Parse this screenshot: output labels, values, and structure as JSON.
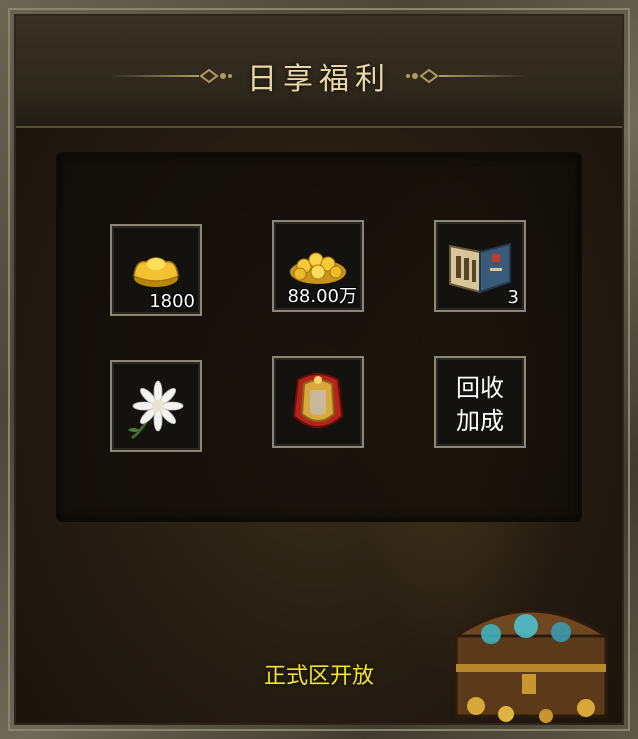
{
  "header": {
    "title": "日享福利"
  },
  "rewards": [
    {
      "icon": "gold-ingot-icon",
      "count": "1800"
    },
    {
      "icon": "gold-coin-pile-icon",
      "count": "88.00万"
    },
    {
      "icon": "skill-book-icon",
      "count": "3"
    },
    {
      "icon": "white-chrysanthemum-icon",
      "count": ""
    },
    {
      "icon": "red-armor-icon",
      "count": ""
    },
    {
      "icon": "",
      "label": "回收\n加成"
    }
  ],
  "footer": {
    "status_text": "正式区开放"
  },
  "colors": {
    "title": "#e8d6a6",
    "footer_text": "#f4e32e",
    "slot_border": "#8c8878"
  }
}
